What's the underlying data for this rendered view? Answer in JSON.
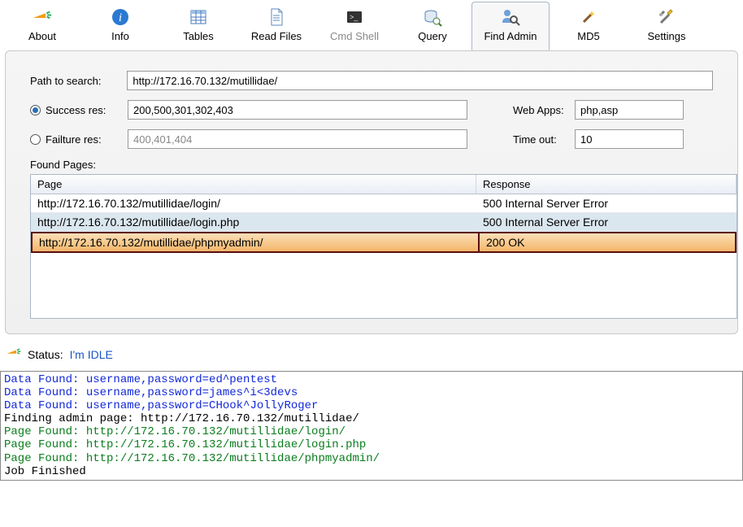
{
  "toolbar": {
    "about": "About",
    "info": "Info",
    "tables": "Tables",
    "read_files": "Read Files",
    "cmd_shell": "Cmd Shell",
    "query": "Query",
    "find_admin": "Find Admin",
    "md5": "MD5",
    "settings": "Settings"
  },
  "form": {
    "path_label": "Path to search:",
    "path_value": "http://172.16.70.132/mutillidae/",
    "success_label": "Success res:",
    "success_value": "200,500,301,302,403",
    "failure_label": "Failture res:",
    "failure_value": "400,401,404",
    "webapps_label": "Web Apps:",
    "webapps_value": "php,asp",
    "timeout_label": "Time out:",
    "timeout_value": "10",
    "found_label": "Found Pages:"
  },
  "grid": {
    "col_page": "Page",
    "col_resp": "Response",
    "rows": [
      {
        "page": "http://172.16.70.132/mutillidae/login/",
        "resp": "500 Internal Server Error"
      },
      {
        "page": "http://172.16.70.132/mutillidae/login.php",
        "resp": "500 Internal Server Error"
      },
      {
        "page": "http://172.16.70.132/mutillidae/phpmyadmin/",
        "resp": "200 OK"
      }
    ]
  },
  "status": {
    "label": "Status:",
    "value": "I'm IDLE"
  },
  "log": {
    "l1": "Data Found: username,password=ed^pentest",
    "l2": "Data Found: username,password=james^i<3devs",
    "l3": "Data Found: username,password=CHook^JollyRoger",
    "l4": "Finding admin page: http://172.16.70.132/mutillidae/",
    "l5": "Page Found: http://172.16.70.132/mutillidae/login/",
    "l6": "Page Found: http://172.16.70.132/mutillidae/login.php",
    "l7": "Page Found: http://172.16.70.132/mutillidae/phpmyadmin/",
    "l8": "Job Finished"
  }
}
